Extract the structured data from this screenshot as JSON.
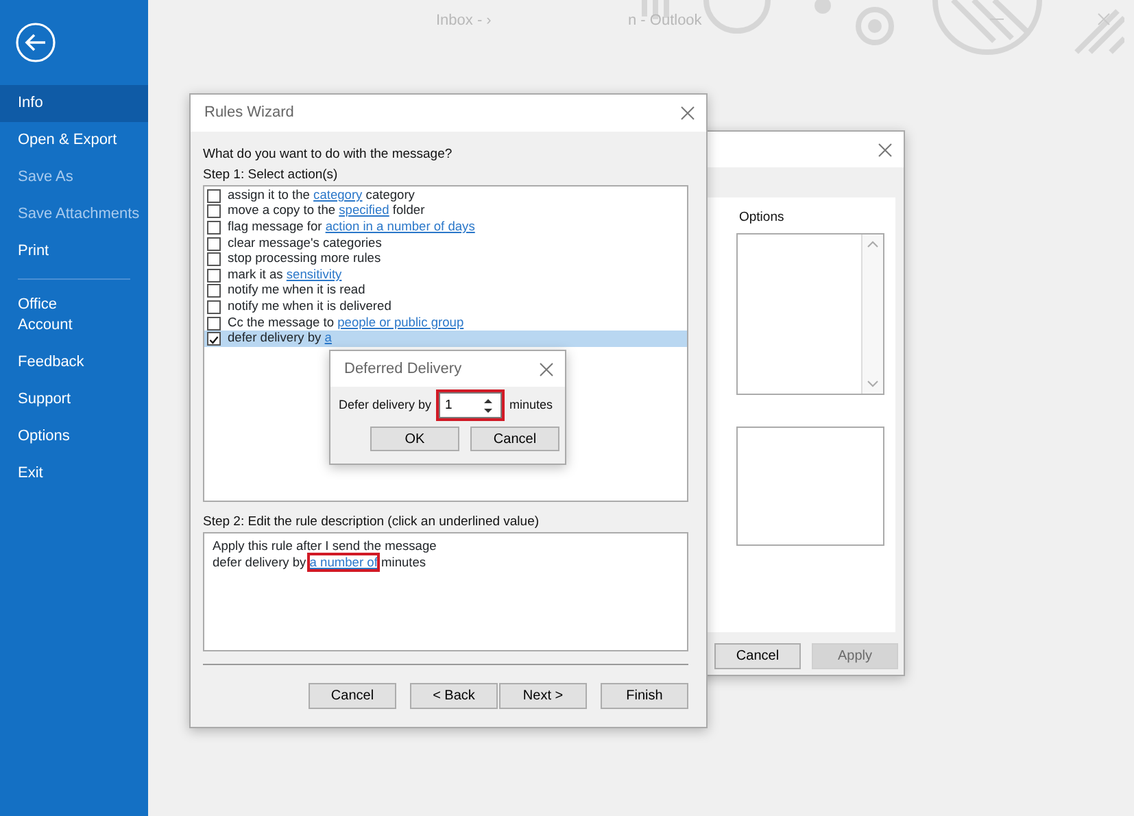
{
  "sidebar": {
    "items": [
      {
        "label": "Info",
        "selected": true,
        "disabled": false
      },
      {
        "label": "Open & Export",
        "selected": false,
        "disabled": false
      },
      {
        "label": "Save As",
        "selected": false,
        "disabled": true
      },
      {
        "label": "Save Attachments",
        "selected": false,
        "disabled": true
      },
      {
        "label": "Print",
        "selected": false,
        "disabled": false,
        "divider_after": true
      },
      {
        "label": "Office Account",
        "selected": false,
        "disabled": false
      },
      {
        "label": "Feedback",
        "selected": false,
        "disabled": false
      },
      {
        "label": "Support",
        "selected": false,
        "disabled": false
      },
      {
        "label": "Options",
        "selected": false,
        "disabled": false
      },
      {
        "label": "Exit",
        "selected": false,
        "disabled": false
      }
    ]
  },
  "title_bar": {
    "title_left": "Inbox - ›",
    "title_right": "n - Outlook"
  },
  "rules_and_alerts": {
    "options_label": "Options",
    "buttons": [
      {
        "label": "Cancel",
        "disabled": false
      },
      {
        "label": "Apply",
        "disabled": true
      }
    ]
  },
  "rules_wizard": {
    "title": "Rules Wizard",
    "question": "What do you want to do with the message?",
    "step1_label": "Step 1: Select action(s)",
    "actions": [
      {
        "parts": [
          {
            "text": "assign it to the "
          },
          {
            "text": "category",
            "link": true
          },
          {
            "text": " category"
          }
        ],
        "checked": false,
        "selected": false
      },
      {
        "parts": [
          {
            "text": "move a copy to the "
          },
          {
            "text": "specified",
            "link": true
          },
          {
            "text": " folder"
          }
        ],
        "checked": false,
        "selected": false
      },
      {
        "parts": [
          {
            "text": "flag message for "
          },
          {
            "text": "action in a number of days",
            "link": true
          }
        ],
        "checked": false,
        "selected": false
      },
      {
        "parts": [
          {
            "text": "clear message's categories"
          }
        ],
        "checked": false,
        "selected": false
      },
      {
        "parts": [
          {
            "text": "stop processing more rules"
          }
        ],
        "checked": false,
        "selected": false
      },
      {
        "parts": [
          {
            "text": "mark it as "
          },
          {
            "text": "sensitivity",
            "link": true
          }
        ],
        "checked": false,
        "selected": false
      },
      {
        "parts": [
          {
            "text": "notify me when it is read"
          }
        ],
        "checked": false,
        "selected": false
      },
      {
        "parts": [
          {
            "text": "notify me when it is delivered"
          }
        ],
        "checked": false,
        "selected": false
      },
      {
        "parts": [
          {
            "text": "Cc the message to "
          },
          {
            "text": "people or public group",
            "link": true
          }
        ],
        "checked": false,
        "selected": false
      },
      {
        "parts": [
          {
            "text": "defer delivery by "
          },
          {
            "text": "a",
            "link": true
          }
        ],
        "checked": true,
        "selected": true
      }
    ],
    "step2_label": "Step 2: Edit the rule description (click an underlined value)",
    "description": [
      [
        {
          "text": "Apply this rule after I send the message"
        }
      ],
      [
        {
          "text": "defer delivery by "
        },
        {
          "text": "a number of",
          "link": true,
          "highlighted": true
        },
        {
          "text": " minutes"
        }
      ]
    ],
    "buttons": [
      {
        "label": "Cancel",
        "kind": "single"
      },
      {
        "label": "< Back",
        "kind": "pair"
      },
      {
        "label": "Next >",
        "kind": "pair"
      },
      {
        "label": "Finish",
        "kind": "single"
      }
    ]
  },
  "deferred_delivery": {
    "title": "Deferred Delivery",
    "label": "Defer delivery by",
    "value": "1",
    "unit": "minutes",
    "highlighted": true,
    "buttons": [
      {
        "label": "OK"
      },
      {
        "label": "Cancel"
      }
    ]
  }
}
